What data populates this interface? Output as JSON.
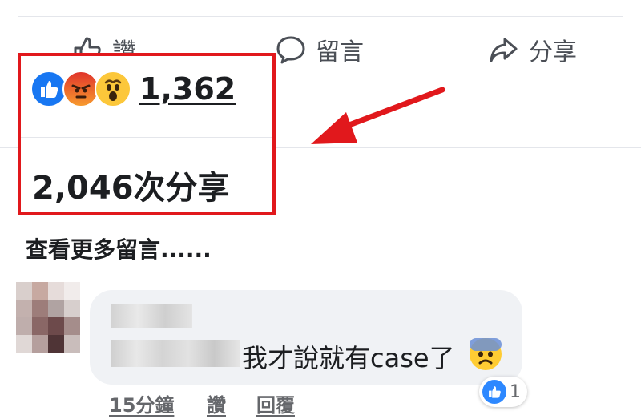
{
  "action_bar": {
    "like_label": "讚",
    "comment_label": "留言",
    "share_label": "分享"
  },
  "highlight": {
    "reactions": [
      {
        "name": "like",
        "icon": "thumbs-up-icon",
        "color": "#1877f2"
      },
      {
        "name": "angry",
        "icon": "angry-face-icon",
        "color": "#f0533c"
      },
      {
        "name": "wow",
        "icon": "surprised-face-icon",
        "color": "#f7b125"
      }
    ],
    "reaction_count": "1,362",
    "shares_text": "2,046次分享",
    "border_color": "#e1181c"
  },
  "view_more": "查看更多留言......",
  "comment": {
    "text": "我才說就有case了",
    "emoji_icon": "fearful-face-icon",
    "time": "15分鐘",
    "like_label": "讚",
    "reply_label": "回覆",
    "like_count": "1"
  },
  "colors": {
    "accent_red": "#e1181c",
    "bubble_bg": "#f0f2f5",
    "facebook_blue": "#1877f2"
  }
}
